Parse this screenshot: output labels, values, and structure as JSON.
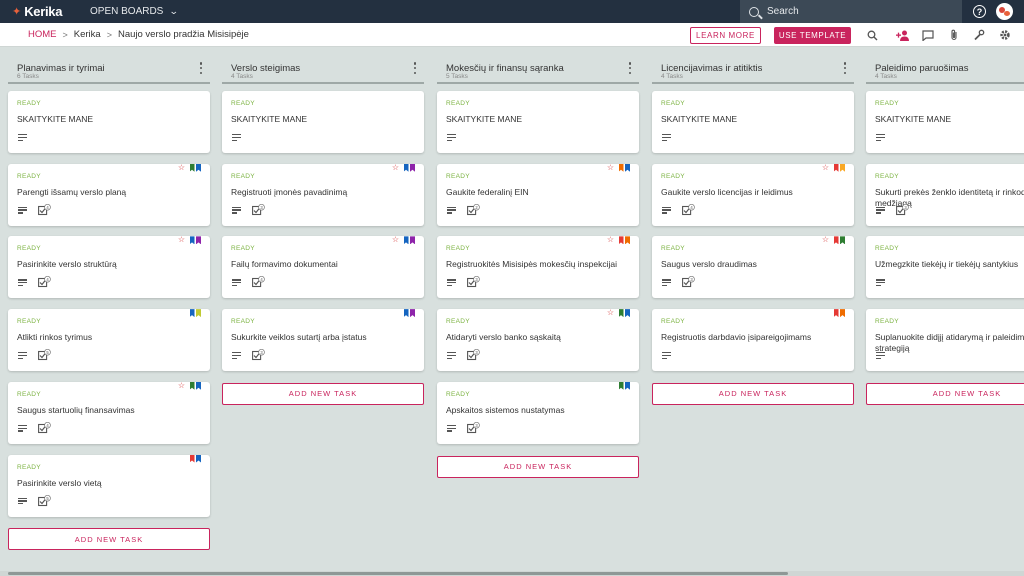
{
  "app": {
    "logo_text": "Kerika",
    "open_boards": "OPEN BOARDS"
  },
  "search": {
    "placeholder": "Search"
  },
  "breadcrumb": {
    "home": "HOME",
    "org": "Kerika",
    "board": "Naujo verslo pradžia Misisipėje"
  },
  "buttons": {
    "learn_more": "LEARN MORE",
    "use_template": "USE TEMPLATE",
    "add_task": "ADD NEW TASK"
  },
  "colors": {
    "accent": "#c9245d",
    "status_ready": "#7cb342",
    "topbar": "#233040",
    "board_bg": "#d8e0de"
  },
  "columns": [
    {
      "title": "Planavimas ir tyrimai",
      "count": "6 Tasks",
      "cards": [
        {
          "status": "READY",
          "title": "SKAITYKITE MANE",
          "star": false,
          "flags": [],
          "checklist": false
        },
        {
          "status": "READY",
          "title": "Parengti išsamų verslo planą",
          "star": true,
          "flags": [
            "#2e7d32",
            "#1565c0"
          ],
          "checklist": true,
          "count": "4"
        },
        {
          "status": "READY",
          "title": "Pasirinkite verslo struktūrą",
          "star": true,
          "flags": [
            "#1565c0",
            "#8e24aa"
          ],
          "checklist": true,
          "count": "4"
        },
        {
          "status": "READY",
          "title": "Atlikti rinkos tyrimus",
          "star": false,
          "flags": [
            "#1565c0",
            "#c0ca33"
          ],
          "checklist": true,
          "count": "5"
        },
        {
          "status": "READY",
          "title": "Saugus startuolių finansavimas",
          "star": true,
          "flags": [
            "#2e7d32",
            "#1565c0"
          ],
          "checklist": true,
          "count": "4"
        },
        {
          "status": "READY",
          "title": "Pasirinkite verslo vietą",
          "star": false,
          "flags": [
            "#e53935",
            "#1565c0"
          ],
          "checklist": true,
          "count": "5"
        }
      ]
    },
    {
      "title": "Verslo steigimas",
      "count": "4 Tasks",
      "cards": [
        {
          "status": "READY",
          "title": "SKAITYKITE MANE",
          "star": false,
          "flags": [],
          "checklist": false
        },
        {
          "status": "READY",
          "title": "Registruoti įmonės pavadinimą",
          "star": true,
          "flags": [
            "#1565c0",
            "#8e24aa"
          ],
          "checklist": true,
          "count": "3"
        },
        {
          "status": "READY",
          "title": "Failų formavimo dokumentai",
          "star": true,
          "flags": [
            "#1565c0",
            "#8e24aa"
          ],
          "checklist": true,
          "count": "4"
        },
        {
          "status": "READY",
          "title": "Sukurkite veiklos sutartį arba įstatus",
          "star": false,
          "flags": [
            "#1565c0",
            "#8e24aa"
          ],
          "checklist": true,
          "count": "3"
        }
      ]
    },
    {
      "title": "Mokesčių ir finansų sąranka",
      "count": "5 Tasks",
      "cards": [
        {
          "status": "READY",
          "title": "SKAITYKITE MANE",
          "star": false,
          "flags": [],
          "checklist": false
        },
        {
          "status": "READY",
          "title": "Gaukite federalinį EIN",
          "star": true,
          "flags": [
            "#ef6c00",
            "#1565c0"
          ],
          "checklist": true,
          "count": "2"
        },
        {
          "status": "READY",
          "title": "Registruokitės Misisipės mokesčių inspekcijai",
          "star": true,
          "flags": [
            "#e53935",
            "#ef6c00"
          ],
          "checklist": true,
          "count": "3"
        },
        {
          "status": "READY",
          "title": "Atidaryti verslo banko sąskaitą",
          "star": true,
          "flags": [
            "#2e7d32",
            "#1565c0"
          ],
          "checklist": true,
          "count": "3"
        },
        {
          "status": "READY",
          "title": "Apskaitos sistemos nustatymas",
          "star": false,
          "flags": [
            "#2e7d32",
            "#1565c0"
          ],
          "checklist": true,
          "count": "3"
        }
      ]
    },
    {
      "title": "Licencijavimas ir atitiktis",
      "count": "4 Tasks",
      "cards": [
        {
          "status": "READY",
          "title": "SKAITYKITE MANE",
          "star": false,
          "flags": [],
          "checklist": false
        },
        {
          "status": "READY",
          "title": "Gaukite verslo licencijas ir leidimus",
          "star": true,
          "flags": [
            "#e53935",
            "#f9a825"
          ],
          "checklist": true,
          "count": "4"
        },
        {
          "status": "READY",
          "title": "Saugus verslo draudimas",
          "star": true,
          "flags": [
            "#e53935",
            "#2e7d32"
          ],
          "checklist": true,
          "count": "3"
        },
        {
          "status": "READY",
          "title": "Registruotis darbdavio įsipareigojimams",
          "star": false,
          "flags": [
            "#e53935",
            "#ef6c00"
          ],
          "checklist": false
        }
      ]
    },
    {
      "title": "Paleidimo paruošimas",
      "count": "4 Tasks",
      "cards": [
        {
          "status": "READY",
          "title": "SKAITYKITE MANE",
          "star": false,
          "flags": [],
          "checklist": false
        },
        {
          "status": "READY",
          "title": "Sukurti prekės ženklo identitetą ir rinkodaros medžiagą",
          "star": false,
          "flags": [],
          "checklist": true,
          "count": "3",
          "two_line": true
        },
        {
          "status": "READY",
          "title": "Užmegzkite tiekėjų ir tiekėjų santykius",
          "star": false,
          "flags": [],
          "checklist": false
        },
        {
          "status": "READY",
          "title": "Suplanuokite didįjį atidarymą ir paleidimo strategiją",
          "star": false,
          "flags": [],
          "checklist": false,
          "two_line": true
        }
      ]
    }
  ]
}
